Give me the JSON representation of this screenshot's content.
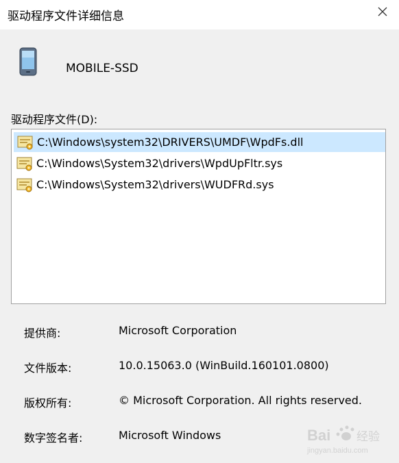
{
  "window": {
    "title": "驱动程序文件详细信息"
  },
  "device": {
    "name": "MOBILE-SSD"
  },
  "driver_files": {
    "label": "驱动程序文件(D):",
    "items": [
      {
        "path": "C:\\Windows\\system32\\DRIVERS\\UMDF\\WpdFs.dll",
        "selected": true
      },
      {
        "path": "C:\\Windows\\System32\\drivers\\WpdUpFltr.sys",
        "selected": false
      },
      {
        "path": "C:\\Windows\\System32\\drivers\\WUDFRd.sys",
        "selected": false
      }
    ]
  },
  "details": {
    "provider_label": "提供商:",
    "provider_value": "Microsoft Corporation",
    "version_label": "文件版本:",
    "version_value": "10.0.15063.0 (WinBuild.160101.0800)",
    "copyright_label": "版权所有:",
    "copyright_value": "© Microsoft Corporation. All rights reserved.",
    "signer_label": "数字签名者:",
    "signer_value": "Microsoft Windows"
  },
  "watermark": {
    "brand": "Bai",
    "brand2": "经验",
    "url": "jingyan.baidu.com"
  },
  "colors": {
    "selection": "#cce8ff",
    "background": "#f0f0f0",
    "titlebar": "#ffffff"
  }
}
